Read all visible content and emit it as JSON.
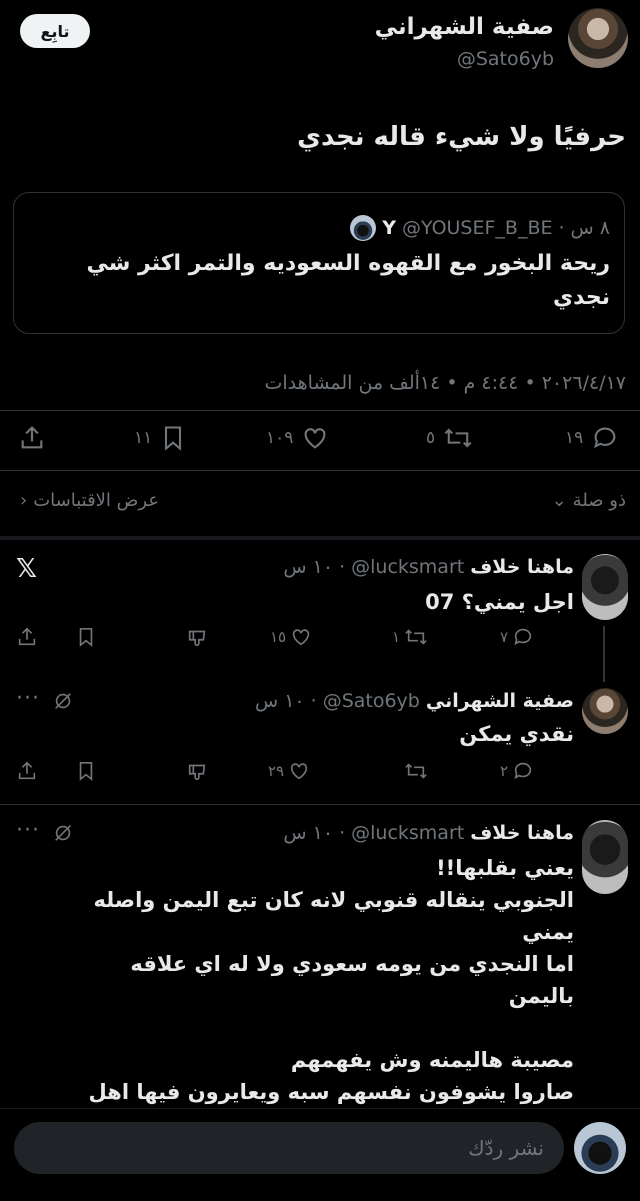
{
  "main_tweet": {
    "author_name": "صفية الشهراني",
    "handle": "@Sato6yb",
    "follow_label": "تابِع",
    "text": "حرفيًا ولا شيء قاله نجدي",
    "quote": {
      "name": "Y",
      "handle": "@YOUSEF_B_BE",
      "time": "٨ س",
      "text_line1": "ريحة البخور مع القهوه السعوديه والتمر اكثر شي",
      "text_line2": "نجدي"
    },
    "meta": "٢٠٢٦/٤/١٧ • ٤:٤٤ م • ١٤ألف من المشاهدات",
    "actions": {
      "replies": "١٩",
      "reposts": "٥",
      "likes": "١٠٩",
      "bookmarks": "١١"
    },
    "related_label": "ذو صلة",
    "quotes_label": "عرض الاقتباسات"
  },
  "replies": [
    {
      "name": "ماهنا خلاف",
      "handle": "@lucksmart",
      "time": "١٠ س",
      "lines": [
        "اجل يمني؟ 07"
      ],
      "replies": "٧",
      "reposts": "١",
      "likes": "١٥"
    },
    {
      "name": "صفية الشهراني",
      "handle": "@Sato6yb",
      "time": "١٠ س",
      "lines": [
        "نقدي يمكن"
      ],
      "replies": "٢",
      "reposts": "",
      "likes": "٢٩"
    },
    {
      "name": "ماهنا خلاف",
      "handle": "@lucksmart",
      "time": "١٠ س",
      "lines": [
        "يعني بقلبها!!",
        "الجنوبي ينقاله قنوبي لانه كان تبع اليمن واصله",
        "يمني",
        "اما النجدي من يومه سعودي ولا له اي علاقه",
        "باليمن",
        "",
        "مصيبة هاليمنه وش يفهمهم",
        "صاروا يشوفون نفسهم سبه ويعايرون فيها اهل"
      ]
    }
  ],
  "composer": {
    "placeholder": "نشر ردّك"
  },
  "colors": {
    "background": "#000000",
    "text": "#e7e9ea",
    "muted": "#71767b",
    "border": "#2f3336",
    "composer_bg": "#202327"
  }
}
